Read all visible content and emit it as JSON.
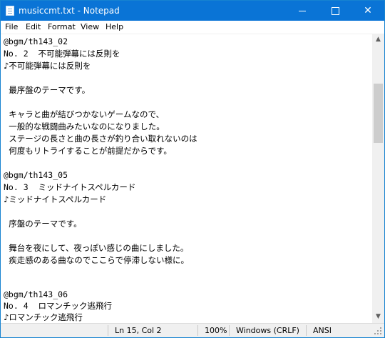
{
  "window": {
    "title": "musiccmt.txt - Notepad"
  },
  "menu": [
    "File",
    "Edit",
    "Format",
    "View",
    "Help"
  ],
  "editor_lines": [
    "@bgm/th143_02",
    "No. 2  不可能弾幕には反則を",
    "♪不可能弾幕には反則を",
    "",
    "  最序盤のテーマです。",
    "",
    "  キャラと曲が結びつかないゲームなので、",
    "  一般的な戦闘曲みたいなのになりました。",
    "  ステージの長さと曲の長さが釣り合い取れないのは",
    "  何度もリトライすることが前提だからです。",
    "",
    "@bgm/th143_05",
    "No. 3  ミッドナイトスペルカード",
    "♪ミッドナイトスペルカード",
    "",
    "  序盤のテーマです。",
    "",
    "  舞台を夜にして、夜っぽい感じの曲にしました。",
    "  疾走感のある曲なのでここらで停滞しない様に。",
    "",
    "",
    "",
    "@bgm/th143_06",
    "No. 4  ロマンチック逃飛行",
    "♪ロマンチック逃飛行"
  ],
  "status": {
    "position": "Ln 15, Col 2",
    "zoom": "100%",
    "line_ending": "Windows (CRLF)",
    "encoding": "ANSI"
  },
  "icons": {
    "app": "notepad-icon",
    "minimize": "minimize-icon",
    "maximize": "maximize-icon",
    "close": "close-icon"
  },
  "colors": {
    "titlebar": "#0a74d6",
    "statusbar": "#f0f0f0"
  }
}
